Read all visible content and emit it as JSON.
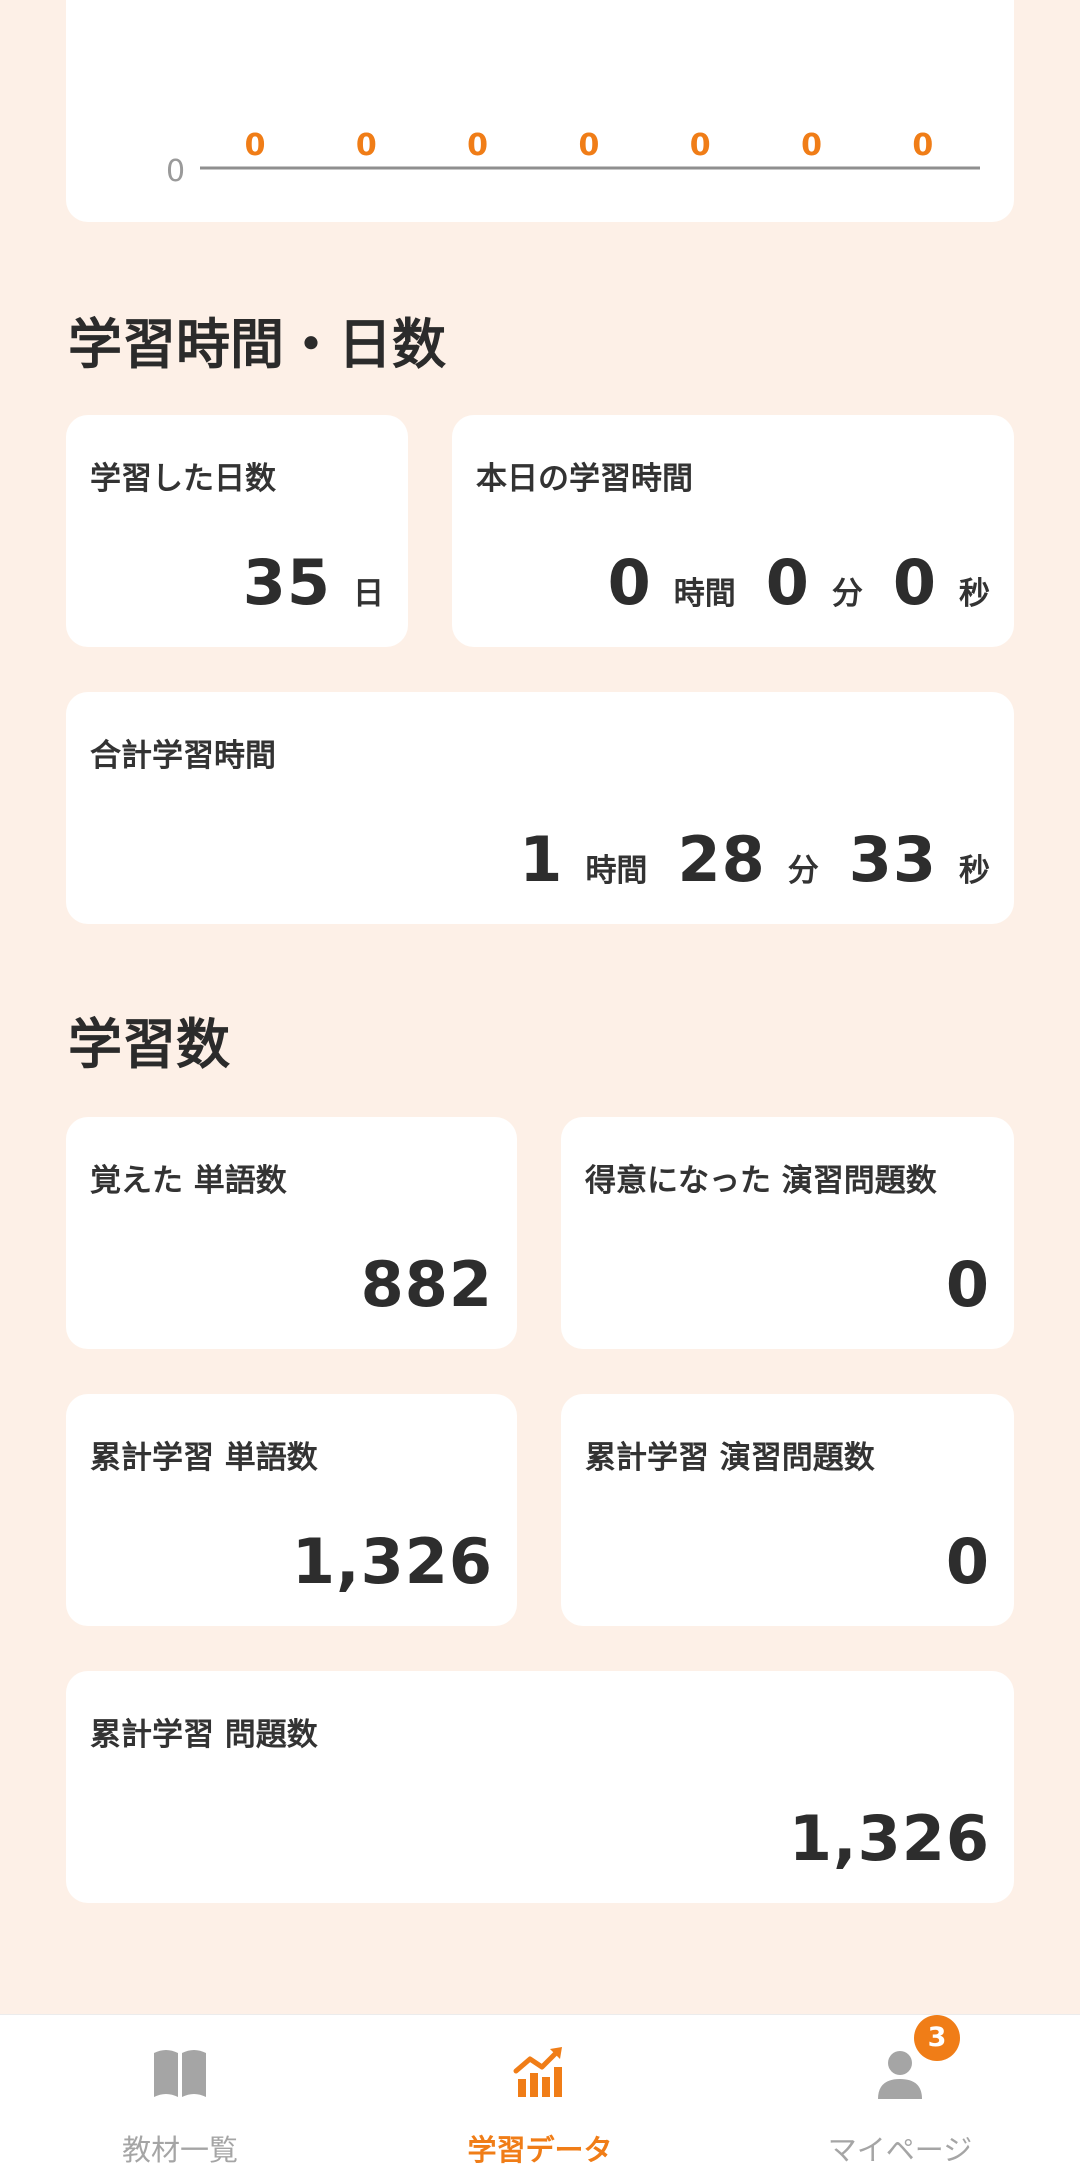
{
  "chart": {
    "y_tick": "0",
    "values": [
      "0",
      "0",
      "0",
      "0",
      "0",
      "0",
      "0"
    ]
  },
  "chart_data": {
    "type": "bar",
    "categories": [
      "",
      "",
      "",
      "",
      "",
      "",
      ""
    ],
    "values": [
      0,
      0,
      0,
      0,
      0,
      0,
      0
    ],
    "title": "",
    "xlabel": "",
    "ylabel": "",
    "ylim": [
      0,
      1
    ],
    "yticks": [
      "0"
    ]
  },
  "study_time_section": {
    "title": "学習時間・日数",
    "days_card": {
      "label": "学習した日数",
      "value": "35",
      "unit": "日"
    },
    "today_card": {
      "label": "本日の学習時間",
      "hours": "0",
      "hours_unit": "時間",
      "minutes": "0",
      "minutes_unit": "分",
      "seconds": "0",
      "seconds_unit": "秒"
    },
    "total_card": {
      "label": "合計学習時間",
      "hours": "1",
      "hours_unit": "時間",
      "minutes": "28",
      "minutes_unit": "分",
      "seconds": "33",
      "seconds_unit": "秒"
    }
  },
  "study_count_section": {
    "title": "学習数",
    "cards": [
      {
        "label": "覚えた 単語数",
        "value": "882"
      },
      {
        "label": "得意になった 演習問題数",
        "value": "0"
      },
      {
        "label": "累計学習 単語数",
        "value": "1,326"
      },
      {
        "label": "累計学習 演習問題数",
        "value": "0"
      },
      {
        "label": "累計学習 問題数",
        "value": "1,326"
      }
    ]
  },
  "bottom_nav": {
    "items": [
      {
        "label": "教材一覧",
        "icon": "book-icon"
      },
      {
        "label": "学習データ",
        "icon": "chart-icon"
      },
      {
        "label": "マイページ",
        "icon": "user-icon"
      }
    ],
    "badge": "3"
  },
  "colors": {
    "accent": "#f07d17",
    "background": "#fdf0e7",
    "inactive": "#a5a5a5"
  }
}
